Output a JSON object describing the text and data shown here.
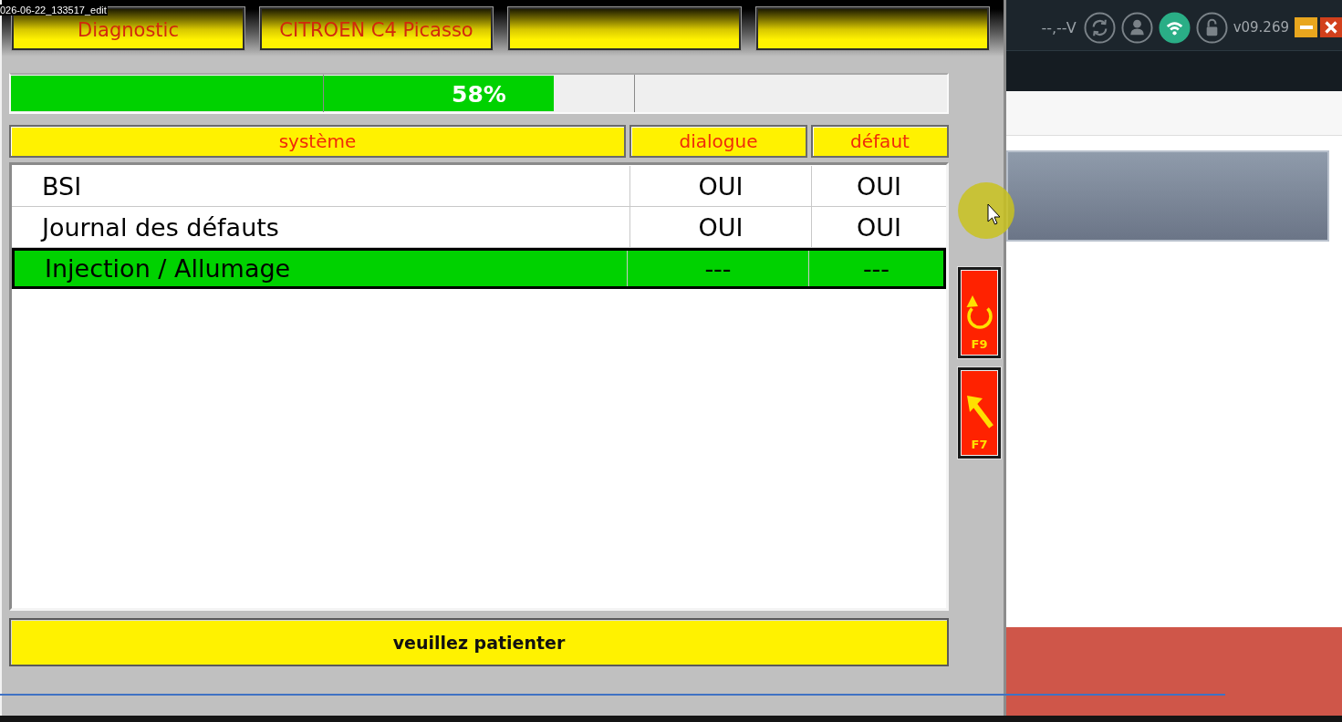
{
  "recording_title": "026-06-22_133517_edit",
  "top_buttons": [
    {
      "kind": "labelled",
      "label": "Diagnostic"
    },
    {
      "kind": "labelled",
      "label": "CITROEN C4 Picasso"
    },
    {
      "kind": "blank"
    },
    {
      "kind": "blank"
    }
  ],
  "progress": {
    "level": 0.58,
    "reading": "58%"
  },
  "table": {
    "columns": [
      "système",
      "dialogue",
      "défaut"
    ],
    "rows": [
      {
        "cells": [
          "BSI",
          "OUI",
          "OUI"
        ],
        "selected": false
      },
      {
        "cells": [
          "Journal des défauts",
          "OUI",
          "OUI"
        ],
        "selected": false
      },
      {
        "cells": [
          "Injection / Allumage",
          "---",
          "---"
        ],
        "selected": true
      }
    ]
  },
  "status": "veuillez patienter",
  "side_buttons": [
    {
      "kind": "refresh",
      "key": "F9"
    },
    {
      "kind": "back",
      "key": "F7"
    }
  ],
  "host_app": {
    "voltage": "--,--V",
    "status_icons": [
      {
        "kind": "sync",
        "active": false
      },
      {
        "kind": "user",
        "active": false
      },
      {
        "kind": "wifi",
        "active": true
      },
      {
        "kind": "lock",
        "active": false
      }
    ],
    "version": "v09.269"
  }
}
